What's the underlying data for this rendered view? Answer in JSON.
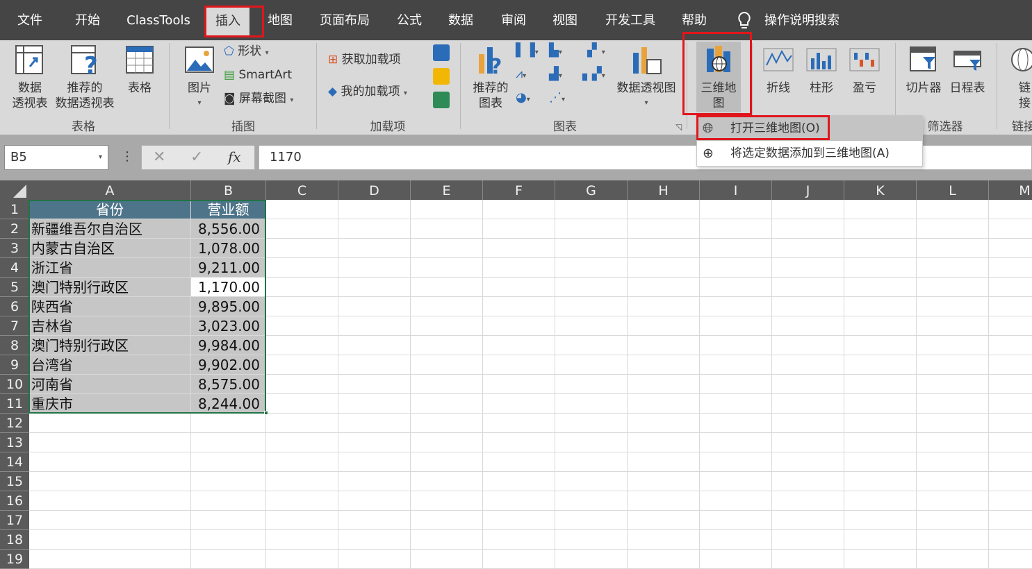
{
  "tabs": [
    "文件",
    "开始",
    "ClassTools",
    "插入",
    "地图",
    "页面布局",
    "公式",
    "数据",
    "审阅",
    "视图",
    "开发工具",
    "帮助"
  ],
  "search": "操作说明搜索",
  "ribbon": {
    "pivot": "数据\n透视表",
    "rec_pivot": "推荐的\n数据透视表",
    "table": "表格",
    "group_tables": "表格",
    "pictures": "图片",
    "shapes": "形状",
    "smartart": "SmartArt",
    "screenshot": "屏幕截图",
    "group_illus": "插图",
    "get_addins": "获取加载项",
    "my_addins": "我的加载项",
    "group_addins": "加载项",
    "rec_charts": "推荐的\n图表",
    "pivot_chart": "数据透视图",
    "group_charts": "图表",
    "map3d": "三维地\n图",
    "line": "折线",
    "column": "柱形",
    "winloss": "盈亏",
    "slicer": "切片器",
    "timeline": "日程表",
    "group_filters": "筛选器",
    "link": "链\n接",
    "group_links": "链接"
  },
  "dropdown": {
    "open": "打开三维地图(O)",
    "add": "将选定数据添加到三维地图(A)"
  },
  "namebox": "B5",
  "formula": "1170",
  "columns": [
    "A",
    "B",
    "C",
    "D",
    "E",
    "F",
    "G",
    "H",
    "I",
    "J",
    "K",
    "L",
    "M"
  ],
  "rows": [
    "1",
    "2",
    "3",
    "4",
    "5",
    "6",
    "7",
    "8",
    "9",
    "10",
    "11",
    "12",
    "13",
    "14",
    "15",
    "16",
    "17",
    "18",
    "19"
  ],
  "table": {
    "headers": [
      "省份",
      "营业额"
    ],
    "data": [
      [
        "新疆维吾尔自治区",
        "8,556.00"
      ],
      [
        "内蒙古自治区",
        "1,078.00"
      ],
      [
        "浙江省",
        "9,211.00"
      ],
      [
        "澳门特别行政区",
        "1,170.00"
      ],
      [
        "陕西省",
        "9,895.00"
      ],
      [
        "吉林省",
        "3,023.00"
      ],
      [
        "澳门特别行政区",
        "9,984.00"
      ],
      [
        "台湾省",
        "9,902.00"
      ],
      [
        "河南省",
        "8,575.00"
      ],
      [
        "重庆市",
        "8,244.00"
      ]
    ]
  }
}
